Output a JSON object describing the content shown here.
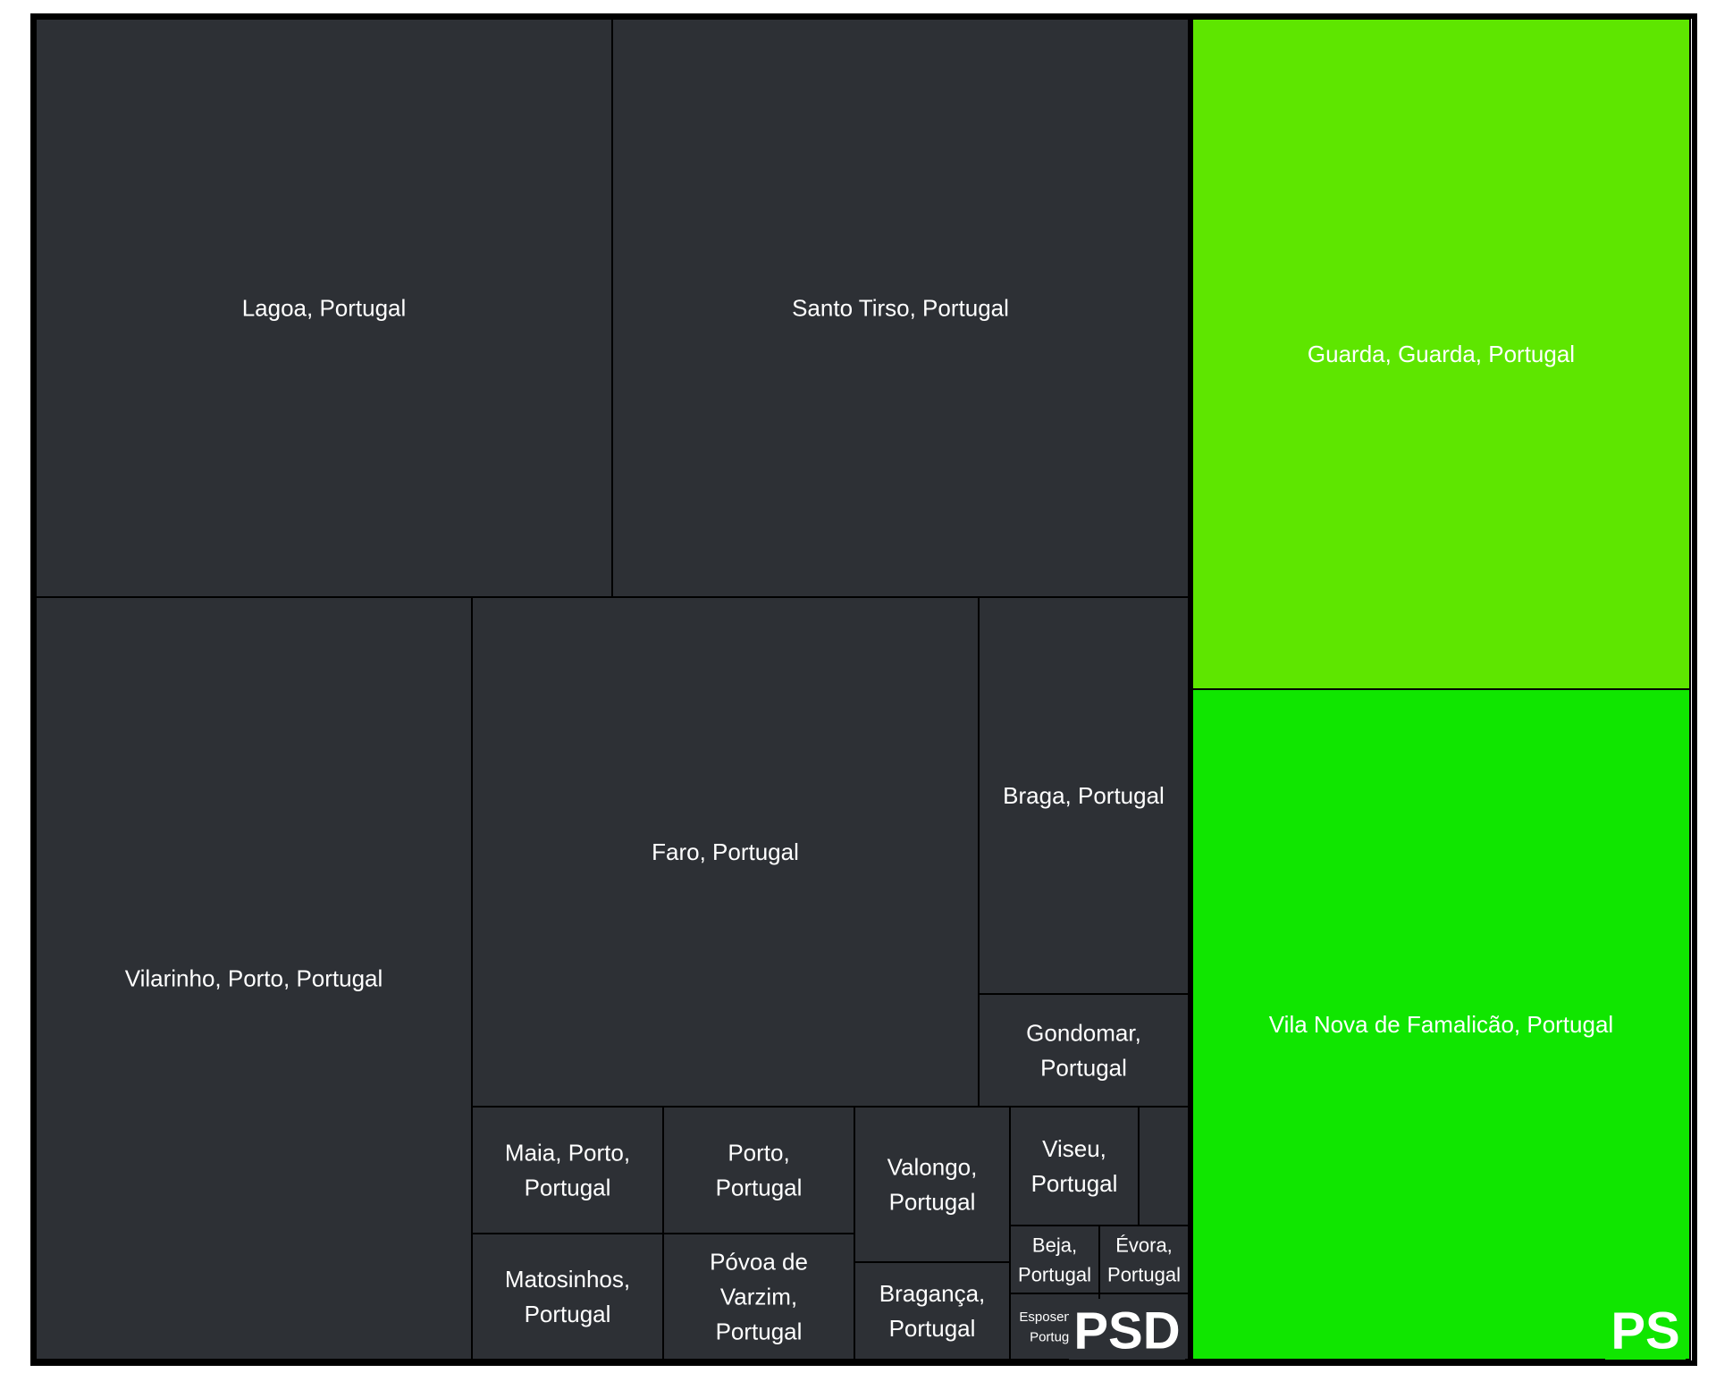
{
  "chart_data": {
    "type": "treemap",
    "colors": {
      "outline": "#000000",
      "PSD": "#2d3035",
      "PS_light": "#5ee600",
      "PS_dark": "#10e600"
    },
    "groups": [
      {
        "name": "PSD",
        "color": "#2d3035",
        "items": [
          {
            "label": "Lagoa, Portugal",
            "lines": [
              "Lagoa, Portugal"
            ],
            "value": 14
          },
          {
            "label": "Santo Tirso, Portugal",
            "lines": [
              "Santo Tirso, Portugal"
            ],
            "value": 14
          },
          {
            "label": "Vilarinho, Porto, Portugal",
            "lines": [
              "Vilarinho, Porto, Portugal"
            ],
            "value": 13
          },
          {
            "label": "Faro, Portugal",
            "lines": [
              "Faro, Portugal"
            ],
            "value": 11
          },
          {
            "label": "Braga, Portugal",
            "lines": [
              "Braga, Portugal"
            ],
            "value": 3.5
          },
          {
            "label": "Gondomar, Portugal",
            "lines": [
              "Gondomar,",
              "Portugal"
            ],
            "value": 1.6
          },
          {
            "label": "Maia, Porto, Portugal",
            "lines": [
              "Maia, Porto,",
              "Portugal"
            ],
            "value": 1
          },
          {
            "label": "Matosinhos, Portugal",
            "lines": [
              "Matosinhos,",
              "Portugal"
            ],
            "value": 1
          },
          {
            "label": "Porto, Portugal",
            "lines": [
              "Porto,",
              "Portugal"
            ],
            "value": 1
          },
          {
            "label": "Póvoa de Varzim, Portugal",
            "lines": [
              "Póvoa de",
              "Varzim,",
              "Portugal"
            ],
            "value": 1
          },
          {
            "label": "Valongo, Portugal",
            "lines": [
              "Valongo,",
              "Portugal"
            ],
            "value": 1
          },
          {
            "label": "Bragança, Portugal",
            "lines": [
              "Bragança,",
              "Portugal"
            ],
            "value": 0.6
          },
          {
            "label": "Viseu, Portugal",
            "lines": [
              "Viseu,",
              "Portugal"
            ],
            "value": 0.7
          },
          {
            "label": "",
            "lines": [],
            "value": 0.25
          },
          {
            "label": "Beja, Portugal",
            "lines": [
              "Beja,",
              "Portugal"
            ],
            "value": 0.3
          },
          {
            "label": "Évora, Portugal",
            "lines": [
              "Évora,",
              "Portugal"
            ],
            "value": 0.3
          },
          {
            "label": "Esposende, Portugal",
            "lines": [
              "Esposende,",
              "Portugal"
            ],
            "value": 0.25
          },
          {
            "label": "",
            "lines": [],
            "value": 0.3
          }
        ]
      },
      {
        "name": "PS",
        "color": "#10e600",
        "items": [
          {
            "label": "Guarda, Guarda, Portugal",
            "lines": [
              "Guarda, Guarda, Portugal"
            ],
            "value": 14,
            "color": "#5ee600"
          },
          {
            "label": "Vila Nova de Famalicão, Portugal",
            "lines": [
              "Vila Nova de Famalicão, Portugal"
            ],
            "value": 14,
            "color": "#10e600"
          }
        ]
      }
    ]
  }
}
